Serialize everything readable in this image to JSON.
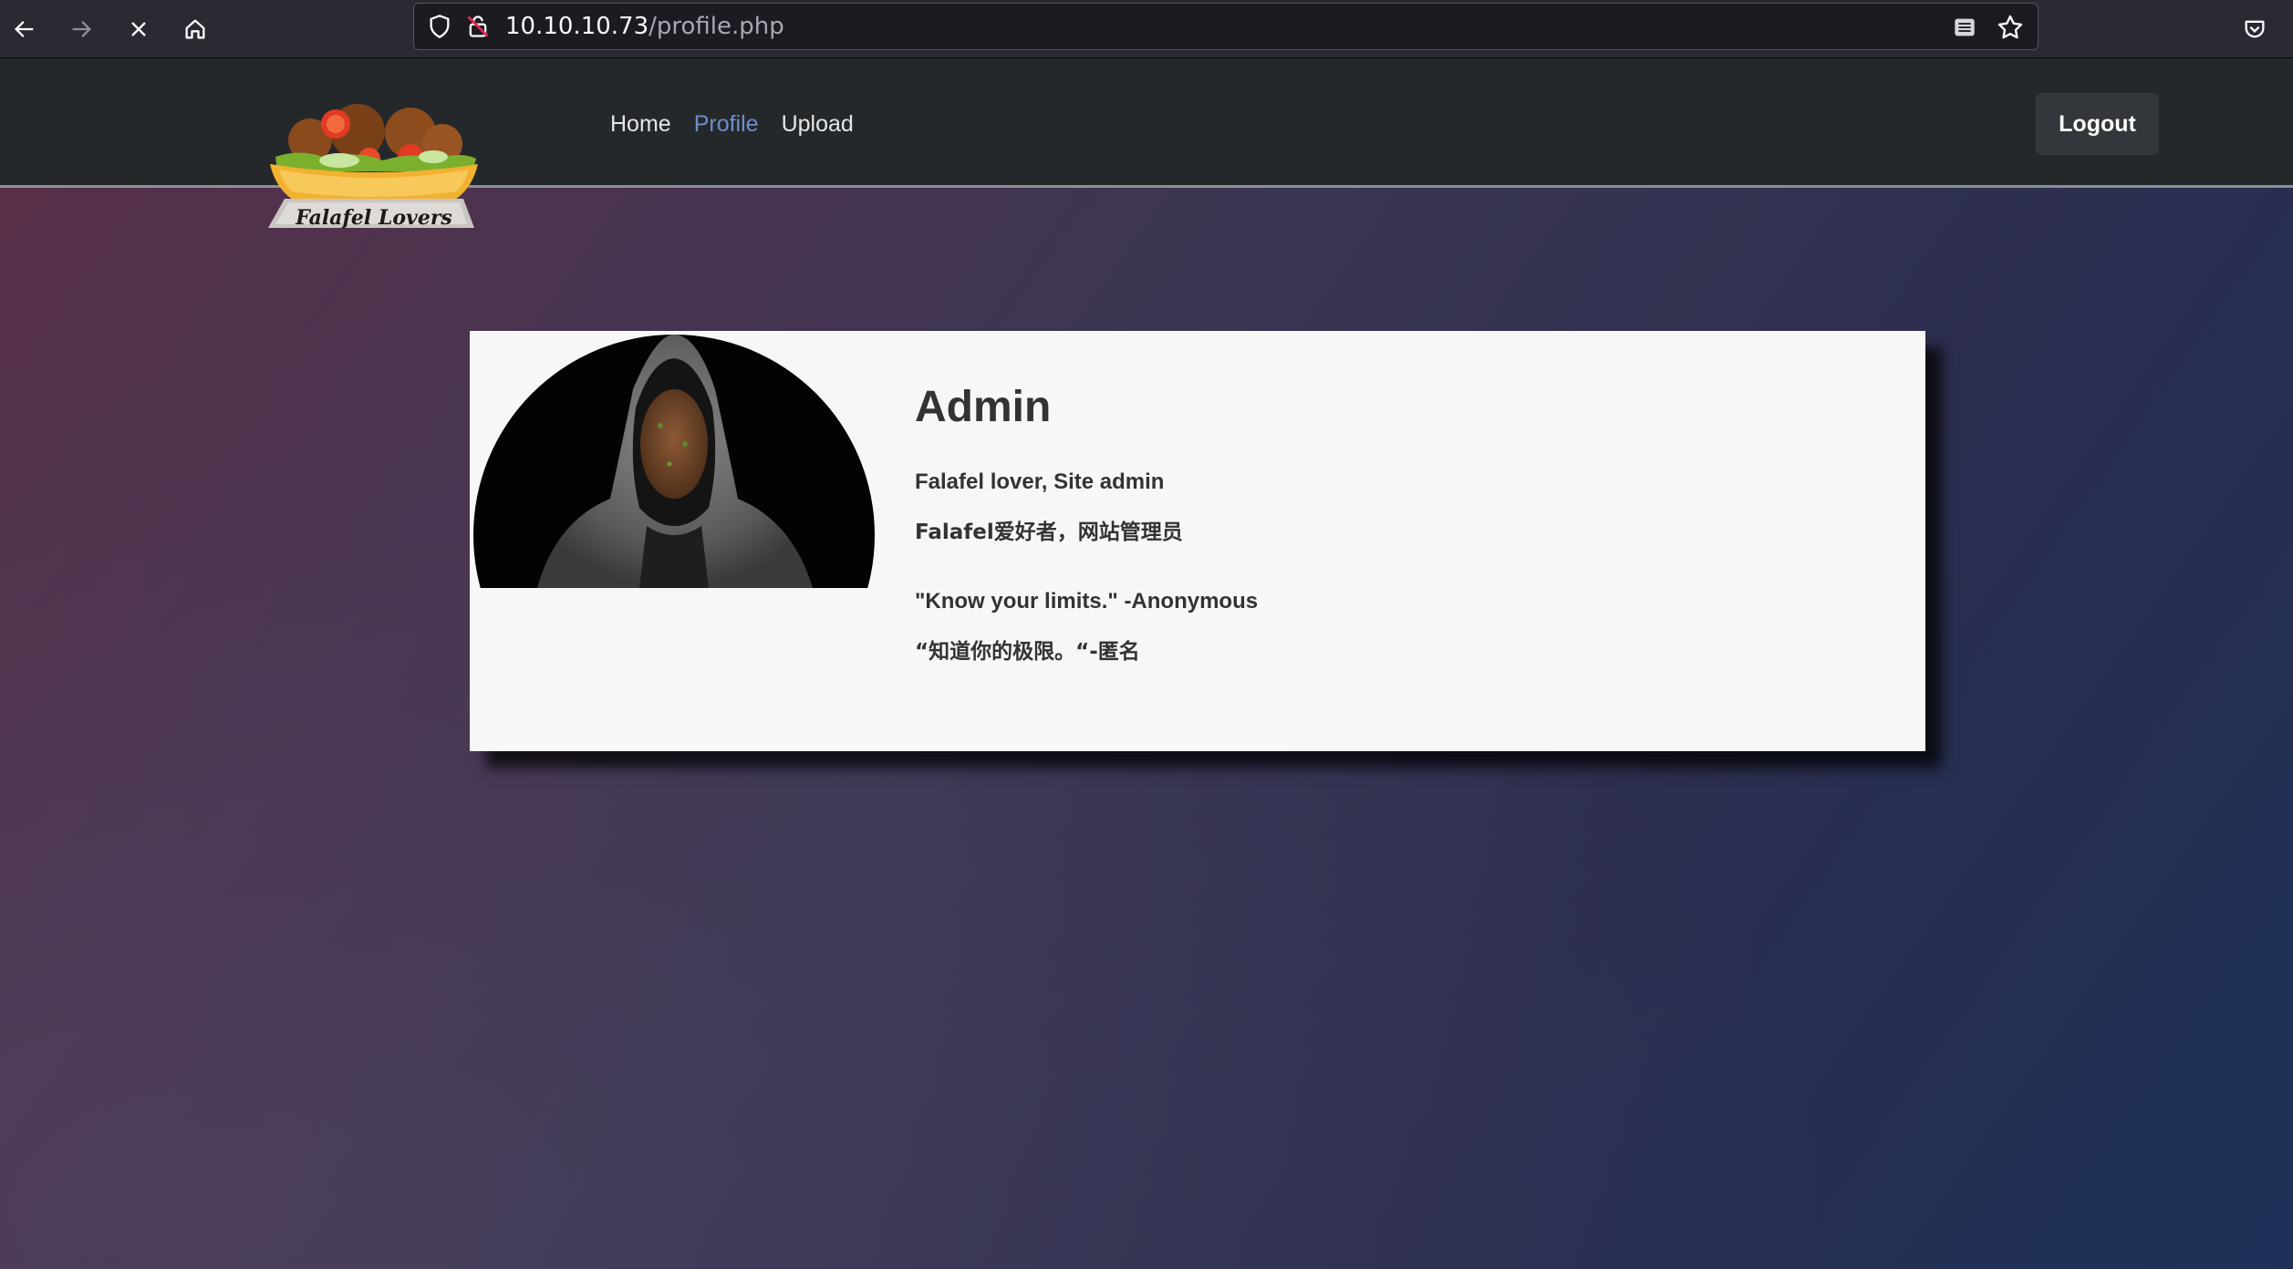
{
  "browser": {
    "url_host": "10.10.10.73",
    "url_path": "/profile.php"
  },
  "site": {
    "logo_text": "Falafel Lovers",
    "nav": [
      {
        "label": "Home",
        "active": false
      },
      {
        "label": "Profile",
        "active": true
      },
      {
        "label": "Upload",
        "active": false
      }
    ],
    "logout_label": "Logout"
  },
  "profile": {
    "name": "Admin",
    "title_en": "Falafel lover, Site admin",
    "title_zh": "Falafel爱好者，网站管理员",
    "quote_en": "\"Know your limits.\" -Anonymous",
    "quote_zh": "“知道你的极限。“-匿名"
  },
  "colors": {
    "nav_active": "#6d8fc9",
    "header_bg": "#25282b"
  }
}
